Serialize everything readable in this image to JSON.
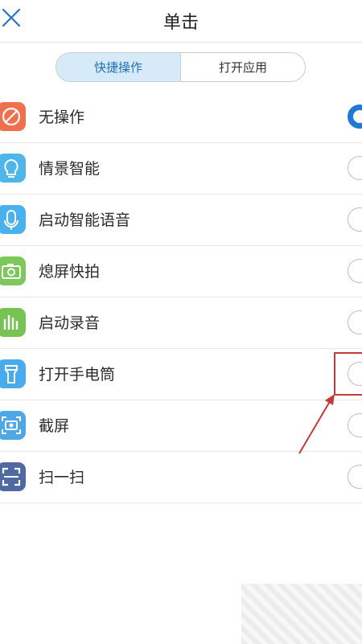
{
  "header": {
    "title": "单击",
    "close_icon": "close-icon"
  },
  "tabs": [
    {
      "label": "快捷操作",
      "active": true
    },
    {
      "label": "打开应用",
      "active": false
    }
  ],
  "items": [
    {
      "label": "无操作",
      "icon": "prohibit-icon",
      "color": "#f0704e",
      "selected": true
    },
    {
      "label": "情景智能",
      "icon": "lightbulb-icon",
      "color": "#4fb6ea",
      "selected": false
    },
    {
      "label": "启动智能语音",
      "icon": "microphone-icon",
      "color": "#48b1ee",
      "selected": false
    },
    {
      "label": "熄屏快拍",
      "icon": "camera-icon",
      "color": "#7cc85a",
      "selected": false
    },
    {
      "label": "启动录音",
      "icon": "sound-bars-icon",
      "color": "#78c253",
      "selected": false
    },
    {
      "label": "打开手电筒",
      "icon": "flashlight-icon",
      "color": "#49abec",
      "selected": false
    },
    {
      "label": "截屏",
      "icon": "screenshot-icon",
      "color": "#4fa8e6",
      "selected": false
    },
    {
      "label": "扫一扫",
      "icon": "scan-icon",
      "color": "#4f6aa3",
      "selected": false
    }
  ],
  "colors": {
    "accent": "#1e7ad6",
    "annotation": "#c33a36"
  }
}
